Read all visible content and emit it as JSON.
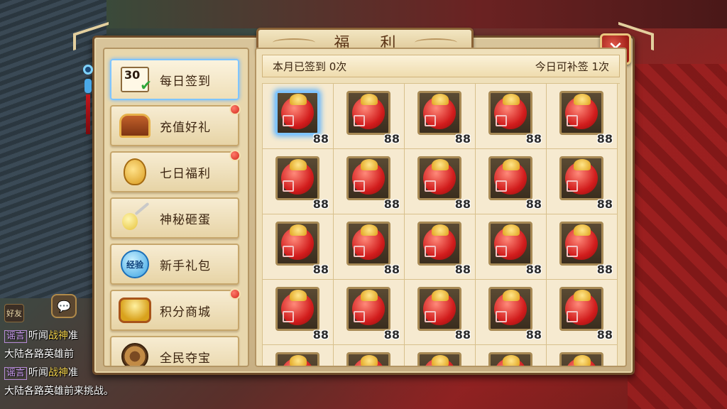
{
  "panel": {
    "title": "福 利"
  },
  "sidebar": {
    "items": [
      {
        "label": "每日签到",
        "icon": "calendar-check-icon",
        "active": true,
        "badge": false,
        "icon_text": "30"
      },
      {
        "label": "充值好礼",
        "icon": "treasure-chest-icon",
        "active": false,
        "badge": true
      },
      {
        "label": "七日福利",
        "icon": "gold-bag-icon",
        "active": false,
        "badge": true
      },
      {
        "label": "神秘砸蛋",
        "icon": "golden-egg-icon",
        "active": false,
        "badge": false
      },
      {
        "label": "新手礼包",
        "icon": "exp-orb-icon",
        "active": false,
        "badge": false,
        "icon_text": "经验"
      },
      {
        "label": "积分商城",
        "icon": "gold-treasure-icon",
        "active": false,
        "badge": true
      },
      {
        "label": "全民夺宝",
        "icon": "compass-icon",
        "active": false,
        "badge": false
      }
    ]
  },
  "main": {
    "signed_text": "本月已签到 0次",
    "makeup_text": "今日可补签 1次",
    "item_count": "88",
    "rows_visible": 5,
    "columns": 5
  },
  "chat": {
    "friend_label": "好友",
    "lines": [
      {
        "tag": "谣言",
        "prefix": "听闻",
        "highlight": "战神",
        "suffix": "准"
      },
      {
        "text": "大陆各路英雄前"
      },
      {
        "tag": "谣言",
        "prefix": "听闻",
        "highlight": "战神",
        "suffix": "准"
      },
      {
        "text": "大陆各路英雄前来挑战。"
      }
    ]
  },
  "colors": {
    "panel_bg": "#d8c49a",
    "accent_blue": "#7fc5ff",
    "badge_red": "#d22a1c",
    "close_red": "#9c1d14"
  }
}
